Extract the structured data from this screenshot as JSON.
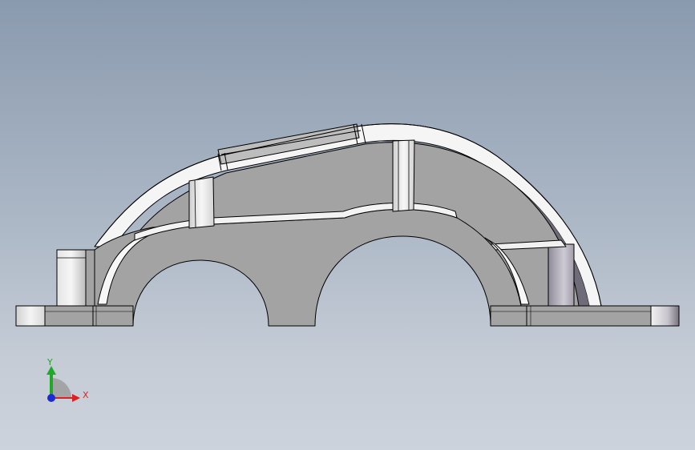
{
  "triad": {
    "x_label": "X",
    "y_label": "Y",
    "x_color": "#e02020",
    "y_color": "#1fa82a",
    "z_color": "#1a2bd6"
  },
  "colors": {
    "background_top": "#8a9aae",
    "background_bottom": "#cdd3dc",
    "part_face": "#a3a3a3",
    "part_highlight": "#f4f4f4",
    "edge": "#000000"
  }
}
